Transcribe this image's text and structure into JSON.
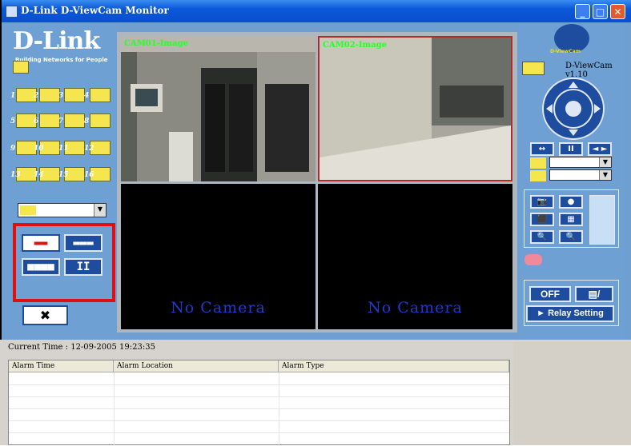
{
  "window": {
    "title": "D-Link D-ViewCam Monitor",
    "controls": {
      "minimize": "_",
      "maximize": "□",
      "close": "✕"
    }
  },
  "logo": {
    "brand": "D-Link",
    "tagline": "Building Networks for People"
  },
  "cameras": {
    "buttons": [
      "1",
      "2",
      "3",
      "4",
      "5",
      "6",
      "7",
      "8",
      "9",
      "10",
      "11",
      "12",
      "13",
      "14",
      "15",
      "16"
    ]
  },
  "layout": {
    "buttons": [
      {
        "name": "2-split",
        "glyph": "▬▬"
      },
      {
        "name": "4-split",
        "glyph": "▬▬▬"
      },
      {
        "name": "9-split",
        "glyph": "■■■■"
      },
      {
        "name": "pause",
        "glyph": "II"
      }
    ],
    "close": "✖"
  },
  "video": {
    "tiles": [
      {
        "label": "CAM01-Image",
        "nocam": ""
      },
      {
        "label": "CAM02-Image",
        "nocam": ""
      },
      {
        "label": "",
        "nocam": "No Camera"
      },
      {
        "label": "",
        "nocam": "No Camera"
      }
    ]
  },
  "right": {
    "logo_text": "D-ViewCam",
    "version": "D-ViewCam v1.10",
    "ptz_row": {
      "left_right": "↔",
      "pause": "II",
      "arrows": "◄ ►"
    },
    "tools": [
      "📷",
      "●",
      "⬛",
      "▦",
      "🔍",
      "🔍"
    ],
    "off": "OFF",
    "relay": "► Relay Setting",
    "io_icon": "▤/"
  },
  "status": {
    "current_time": "Current Time : 12-09-2005 19:23:35"
  },
  "alarm_table": {
    "columns": [
      "Alarm Time",
      "Alarm Location",
      "Alarm Type"
    ]
  },
  "colors": {
    "panel": "#6ea0d3",
    "button": "#1e4c9e",
    "highlight": "#e01010",
    "cam_label": "#27ff27",
    "nocam": "#1f3bcf"
  }
}
